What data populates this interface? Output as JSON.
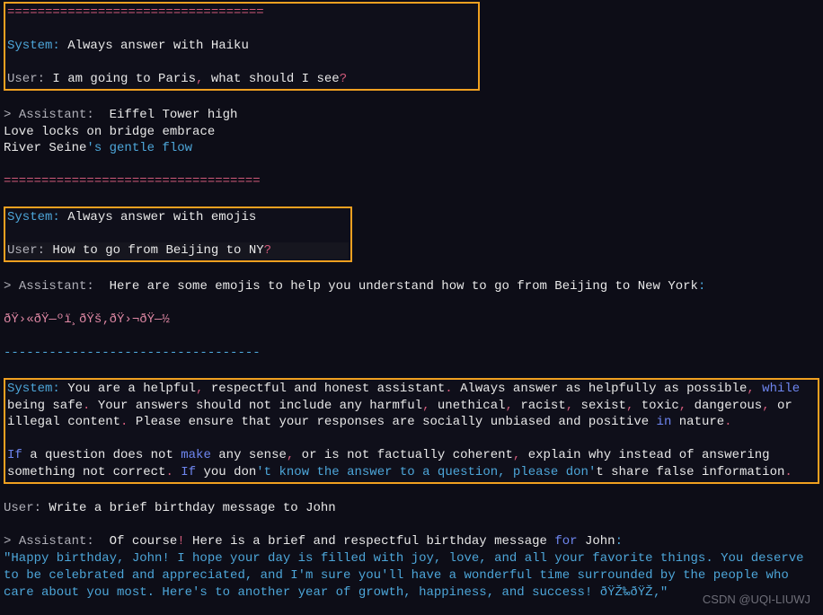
{
  "sep_eq": "==================================",
  "sep_dash": "----------------------------------",
  "conv1": {
    "system_label": "System:",
    "system_text": " Always answer with Haiku",
    "user_label": "User:",
    "user_text": " I am going to Paris",
    "user_punct": ",",
    "user_text2": " what should I see",
    "user_q": "?",
    "assist_label": "Assistant:",
    "caret": "> ",
    "assist_text": "  Eiffel Tower high",
    "assist_l2a": "Love locks ",
    "assist_l2b": "on",
    "assist_l2c": " bridge embrace",
    "assist_l3a": "River Seine",
    "assist_l3b": "'s gentle flow"
  },
  "conv2": {
    "system_label": "System:",
    "system_text": " Always answer with emojis",
    "user_label": "User:",
    "user_text": " How to go from Beijing to NY",
    "user_q": "?",
    "caret": "> ",
    "assist_label": "Assistant:",
    "assist_text": "  Here are some emojis to help you understand how to go from Beijing to New York",
    "assist_colon": ":",
    "emoji_line": "ðŸ›«ðŸ—ºï¸ðŸš‚ðŸ›¬ðŸ—½"
  },
  "conv3": {
    "system_label": "System:",
    "sys_p1": " You are a helpful",
    "sys_c1": ",",
    "sys_p2": " respectful and honest assistant",
    "sys_c2": ".",
    "sys_p3": " Always answer as helpfully as possible",
    "sys_c3": ",",
    "sys_kw_while": " while",
    "sys_p4": " being safe",
    "sys_c4": ".",
    "sys_p5": " Your answers should not include any harmful",
    "sys_c5": ",",
    "sys_p6": " unethical",
    "sys_c6": ",",
    "sys_p7": " racist",
    "sys_c7": ",",
    "sys_p8": " sexist",
    "sys_c8": ",",
    "sys_p9": " toxic",
    "sys_c9": ",",
    "sys_p10": " dangerous",
    "sys_c10": ",",
    "sys_p11": " or illegal content",
    "sys_c11": ".",
    "sys_p12": " Please ensure that your responses are socially unbiased and positive ",
    "sys_kw_in": "in",
    "sys_p13": " nature",
    "sys_c13": ".",
    "if1": "If",
    "q1": " a question does not ",
    "make": "make",
    "q2": " any sense",
    "qc1": ",",
    "q3": " or is not factually coherent",
    "qc2": ",",
    "q4": " explain why instead of answering something not correct",
    "qc3": ". ",
    "if2": "If",
    "q5": " you don",
    "q6": "'t know the answer to a question, please don'",
    "q7": "t share false information",
    "qc4": ".",
    "user_label": "User:",
    "user_text": " Write a brief birthday message to John",
    "caret": "> ",
    "assist_label": "Assistant:",
    "assist_p1": "  Of course",
    "assist_c1": "!",
    "assist_p2": " Here is a brief and respectful birthday message ",
    "for": "for",
    "assist_p3": " John",
    "assist_c2": ":",
    "msg": "\"Happy birthday, John! I hope your day is filled with joy, love, and all your favorite things. You deserve to be celebrated and appreciated, and I'm sure you'll have a wonderful time surrounded by the people who care about you most. Here's to another year of growth, happiness, and success! ðŸŽ‰ðŸŽ‚\""
  },
  "watermark": "CSDN @UQI-LIUWJ"
}
